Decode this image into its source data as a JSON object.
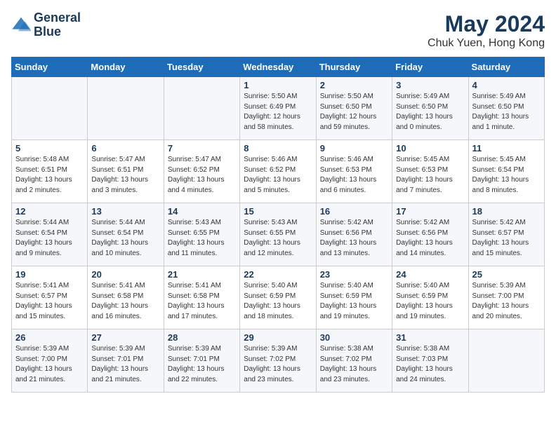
{
  "header": {
    "logo_line1": "General",
    "logo_line2": "Blue",
    "month_year": "May 2024",
    "location": "Chuk Yuen, Hong Kong"
  },
  "days_of_week": [
    "Sunday",
    "Monday",
    "Tuesday",
    "Wednesday",
    "Thursday",
    "Friday",
    "Saturday"
  ],
  "weeks": [
    [
      {
        "day": "",
        "info": ""
      },
      {
        "day": "",
        "info": ""
      },
      {
        "day": "",
        "info": ""
      },
      {
        "day": "1",
        "info": "Sunrise: 5:50 AM\nSunset: 6:49 PM\nDaylight: 12 hours\nand 58 minutes."
      },
      {
        "day": "2",
        "info": "Sunrise: 5:50 AM\nSunset: 6:50 PM\nDaylight: 12 hours\nand 59 minutes."
      },
      {
        "day": "3",
        "info": "Sunrise: 5:49 AM\nSunset: 6:50 PM\nDaylight: 13 hours\nand 0 minutes."
      },
      {
        "day": "4",
        "info": "Sunrise: 5:49 AM\nSunset: 6:50 PM\nDaylight: 13 hours\nand 1 minute."
      }
    ],
    [
      {
        "day": "5",
        "info": "Sunrise: 5:48 AM\nSunset: 6:51 PM\nDaylight: 13 hours\nand 2 minutes."
      },
      {
        "day": "6",
        "info": "Sunrise: 5:47 AM\nSunset: 6:51 PM\nDaylight: 13 hours\nand 3 minutes."
      },
      {
        "day": "7",
        "info": "Sunrise: 5:47 AM\nSunset: 6:52 PM\nDaylight: 13 hours\nand 4 minutes."
      },
      {
        "day": "8",
        "info": "Sunrise: 5:46 AM\nSunset: 6:52 PM\nDaylight: 13 hours\nand 5 minutes."
      },
      {
        "day": "9",
        "info": "Sunrise: 5:46 AM\nSunset: 6:53 PM\nDaylight: 13 hours\nand 6 minutes."
      },
      {
        "day": "10",
        "info": "Sunrise: 5:45 AM\nSunset: 6:53 PM\nDaylight: 13 hours\nand 7 minutes."
      },
      {
        "day": "11",
        "info": "Sunrise: 5:45 AM\nSunset: 6:54 PM\nDaylight: 13 hours\nand 8 minutes."
      }
    ],
    [
      {
        "day": "12",
        "info": "Sunrise: 5:44 AM\nSunset: 6:54 PM\nDaylight: 13 hours\nand 9 minutes."
      },
      {
        "day": "13",
        "info": "Sunrise: 5:44 AM\nSunset: 6:54 PM\nDaylight: 13 hours\nand 10 minutes."
      },
      {
        "day": "14",
        "info": "Sunrise: 5:43 AM\nSunset: 6:55 PM\nDaylight: 13 hours\nand 11 minutes."
      },
      {
        "day": "15",
        "info": "Sunrise: 5:43 AM\nSunset: 6:55 PM\nDaylight: 13 hours\nand 12 minutes."
      },
      {
        "day": "16",
        "info": "Sunrise: 5:42 AM\nSunset: 6:56 PM\nDaylight: 13 hours\nand 13 minutes."
      },
      {
        "day": "17",
        "info": "Sunrise: 5:42 AM\nSunset: 6:56 PM\nDaylight: 13 hours\nand 14 minutes."
      },
      {
        "day": "18",
        "info": "Sunrise: 5:42 AM\nSunset: 6:57 PM\nDaylight: 13 hours\nand 15 minutes."
      }
    ],
    [
      {
        "day": "19",
        "info": "Sunrise: 5:41 AM\nSunset: 6:57 PM\nDaylight: 13 hours\nand 15 minutes."
      },
      {
        "day": "20",
        "info": "Sunrise: 5:41 AM\nSunset: 6:58 PM\nDaylight: 13 hours\nand 16 minutes."
      },
      {
        "day": "21",
        "info": "Sunrise: 5:41 AM\nSunset: 6:58 PM\nDaylight: 13 hours\nand 17 minutes."
      },
      {
        "day": "22",
        "info": "Sunrise: 5:40 AM\nSunset: 6:59 PM\nDaylight: 13 hours\nand 18 minutes."
      },
      {
        "day": "23",
        "info": "Sunrise: 5:40 AM\nSunset: 6:59 PM\nDaylight: 13 hours\nand 19 minutes."
      },
      {
        "day": "24",
        "info": "Sunrise: 5:40 AM\nSunset: 6:59 PM\nDaylight: 13 hours\nand 19 minutes."
      },
      {
        "day": "25",
        "info": "Sunrise: 5:39 AM\nSunset: 7:00 PM\nDaylight: 13 hours\nand 20 minutes."
      }
    ],
    [
      {
        "day": "26",
        "info": "Sunrise: 5:39 AM\nSunset: 7:00 PM\nDaylight: 13 hours\nand 21 minutes."
      },
      {
        "day": "27",
        "info": "Sunrise: 5:39 AM\nSunset: 7:01 PM\nDaylight: 13 hours\nand 21 minutes."
      },
      {
        "day": "28",
        "info": "Sunrise: 5:39 AM\nSunset: 7:01 PM\nDaylight: 13 hours\nand 22 minutes."
      },
      {
        "day": "29",
        "info": "Sunrise: 5:39 AM\nSunset: 7:02 PM\nDaylight: 13 hours\nand 23 minutes."
      },
      {
        "day": "30",
        "info": "Sunrise: 5:38 AM\nSunset: 7:02 PM\nDaylight: 13 hours\nand 23 minutes."
      },
      {
        "day": "31",
        "info": "Sunrise: 5:38 AM\nSunset: 7:03 PM\nDaylight: 13 hours\nand 24 minutes."
      },
      {
        "day": "",
        "info": ""
      }
    ]
  ]
}
